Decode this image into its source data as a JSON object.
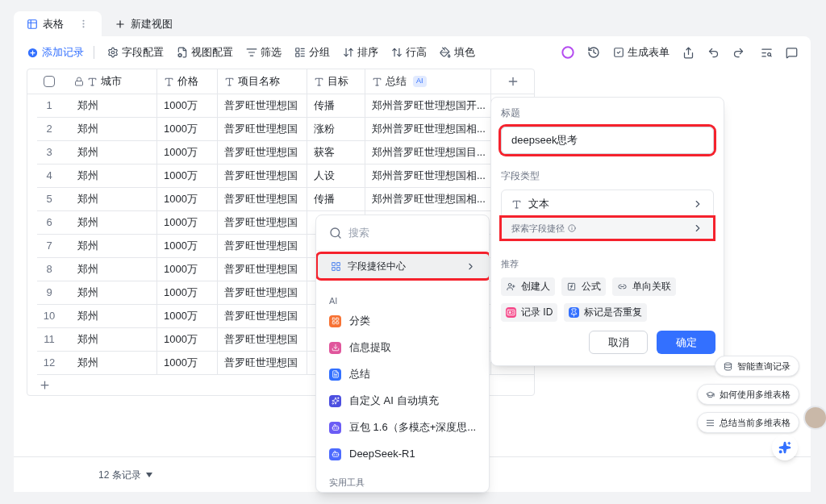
{
  "tabs": [
    {
      "label": "表格",
      "kind": "view",
      "selected": true
    },
    {
      "label": "新建视图",
      "kind": "add",
      "selected": false
    }
  ],
  "toolbar": {
    "add_record": "添加记录",
    "tools": [
      {
        "label": "字段配置",
        "kind": "settings"
      },
      {
        "label": "视图配置",
        "kind": "view"
      },
      {
        "label": "筛选",
        "kind": "filter"
      },
      {
        "label": "分组",
        "kind": "group"
      },
      {
        "label": "排序",
        "kind": "sort"
      },
      {
        "label": "行高",
        "kind": "height"
      },
      {
        "label": "填色",
        "kind": "fill"
      }
    ],
    "generate_form": "生成表单"
  },
  "table": {
    "select_all_checked": false,
    "columns": [
      {
        "label": "城市",
        "locked": true
      },
      {
        "label": "价格",
        "locked": false
      },
      {
        "label": "项目名称",
        "locked": false
      },
      {
        "label": "目标",
        "locked": false
      },
      {
        "label": "总结",
        "locked": false,
        "badge": "AI"
      }
    ],
    "rows": [
      {
        "index": "1",
        "city": "郑州",
        "price": "1000万",
        "project": "普罗旺世理想国",
        "goal": "传播",
        "summary": "郑州普罗旺世理想国开..."
      },
      {
        "index": "2",
        "city": "郑州",
        "price": "1000万",
        "project": "普罗旺世理想国",
        "goal": "涨粉",
        "summary": "郑州普罗旺世理想国相..."
      },
      {
        "index": "3",
        "city": "郑州",
        "price": "1000万",
        "project": "普罗旺世理想国",
        "goal": "获客",
        "summary": "郑州普罗旺世理想国目..."
      },
      {
        "index": "4",
        "city": "郑州",
        "price": "1000万",
        "project": "普罗旺世理想国",
        "goal": "人设",
        "summary": "郑州普罗旺世理想国相..."
      },
      {
        "index": "5",
        "city": "郑州",
        "price": "1000万",
        "project": "普罗旺世理想国",
        "goal": "传播",
        "summary": "郑州普罗旺世理想国相..."
      },
      {
        "index": "6",
        "city": "郑州",
        "price": "1000万",
        "project": "普罗旺世理想国"
      },
      {
        "index": "7",
        "city": "郑州",
        "price": "1000万",
        "project": "普罗旺世理想国"
      },
      {
        "index": "8",
        "city": "郑州",
        "price": "1000万",
        "project": "普罗旺世理想国"
      },
      {
        "index": "9",
        "city": "郑州",
        "price": "1000万",
        "project": "普罗旺世理想国"
      },
      {
        "index": "10",
        "city": "郑州",
        "price": "1000万",
        "project": "普罗旺世理想国"
      },
      {
        "index": "11",
        "city": "郑州",
        "price": "1000万",
        "project": "普罗旺世理想国"
      },
      {
        "index": "12",
        "city": "郑州",
        "price": "1000万",
        "project": "普罗旺世理想国"
      }
    ]
  },
  "footer": {
    "record_count": "12 条记录"
  },
  "field_menu": {
    "search_placeholder": "搜索",
    "shortcut_center": {
      "label": "字段捷径中心",
      "highlighted": true
    },
    "ai_heading": "AI",
    "items": [
      {
        "label": "分类",
        "color": "#f77234"
      },
      {
        "label": "信息提取",
        "color": "#e0569c"
      },
      {
        "label": "总结",
        "color": "#3370ff"
      },
      {
        "label": "自定义 AI 自动填充",
        "color": "#4c4fe0"
      },
      {
        "label": "豆包 1.6（多模态+深度思...",
        "color": "#6b5cf5"
      },
      {
        "label": "DeepSeek-R1",
        "color": "#4d6bfe"
      }
    ],
    "tools_heading": "实用工具"
  },
  "field_panel": {
    "title_label": "标题",
    "title_value": "deepseek思考",
    "title_highlighted": true,
    "type_label": "字段类型",
    "type_value": "文本",
    "explore": {
      "label": "探索字段捷径",
      "highlighted": true
    },
    "recommend_label": "推荐",
    "chips": [
      {
        "label": "创建人",
        "kind": "creator"
      },
      {
        "label": "公式",
        "kind": "formula"
      },
      {
        "label": "单向关联",
        "kind": "link"
      },
      {
        "label": "记录 ID",
        "kind": "record_id"
      },
      {
        "label": "标记是否重复",
        "kind": "duplicate"
      }
    ],
    "cancel": "取消",
    "confirm": "确定"
  },
  "assistant": {
    "suggestions": [
      {
        "label": "智能查询记录",
        "kind": "query"
      },
      {
        "label": "如何使用多维表格",
        "kind": "help"
      },
      {
        "label": "总结当前多维表格",
        "kind": "summary"
      }
    ]
  }
}
